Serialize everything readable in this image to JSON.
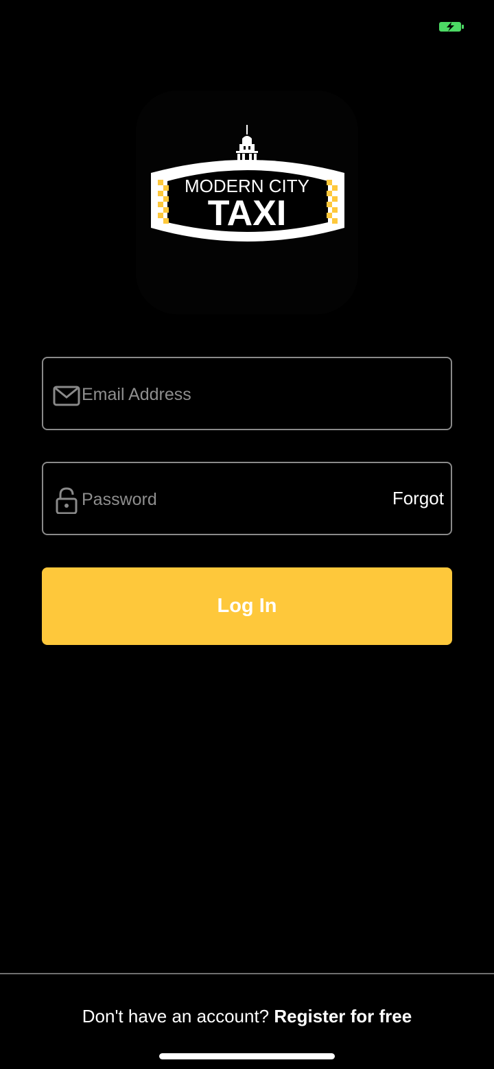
{
  "status_bar": {
    "battery_icon": "battery-charging-icon",
    "battery_color": "#4cd964"
  },
  "logo": {
    "line1": "MODERN CITY",
    "line2": "TAXI",
    "icon": "city-hall-icon",
    "accent_color": "#fec83b"
  },
  "form": {
    "email": {
      "icon": "envelope-icon",
      "placeholder": "Email Address",
      "value": ""
    },
    "password": {
      "icon": "lock-icon",
      "placeholder": "Password",
      "value": "",
      "forgot_label": "Forgot"
    },
    "login_label": "Log In",
    "login_color": "#fec83b"
  },
  "footer": {
    "prompt": "Don't have an account?",
    "register_label": "Register for free"
  }
}
